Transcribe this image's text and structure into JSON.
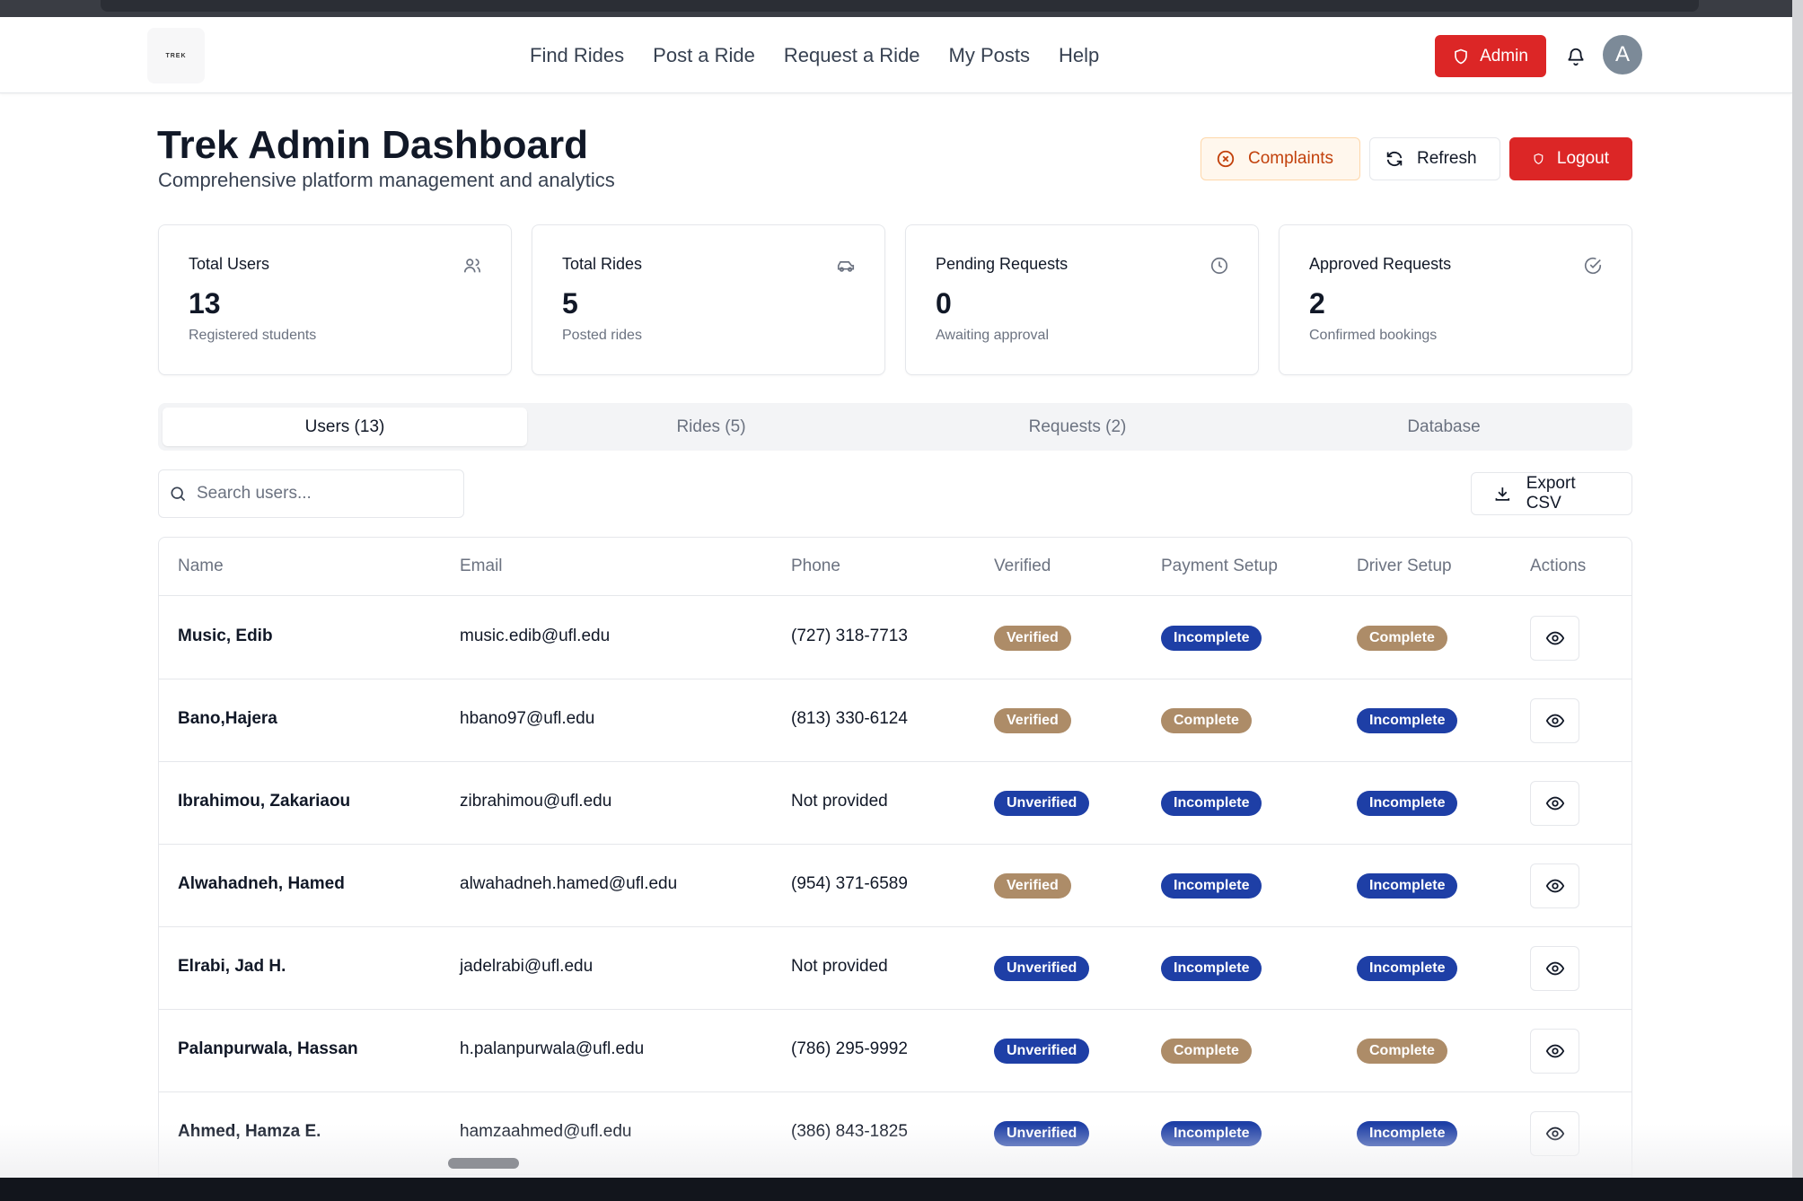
{
  "nav": {
    "logo_text": "TREK",
    "links": [
      "Find Rides",
      "Post a Ride",
      "Request a Ride",
      "My Posts",
      "Help"
    ],
    "admin_label": "Admin",
    "avatar_initial": "A"
  },
  "header": {
    "title": "Trek Admin Dashboard",
    "subtitle": "Comprehensive platform management and analytics",
    "complaints_label": "Complaints",
    "refresh_label": "Refresh",
    "logout_label": "Logout"
  },
  "stats": [
    {
      "title": "Total Users",
      "value": "13",
      "subtitle": "Registered students",
      "icon": "users-icon"
    },
    {
      "title": "Total Rides",
      "value": "5",
      "subtitle": "Posted rides",
      "icon": "car-icon"
    },
    {
      "title": "Pending Requests",
      "value": "0",
      "subtitle": "Awaiting approval",
      "icon": "clock-icon"
    },
    {
      "title": "Approved Requests",
      "value": "2",
      "subtitle": "Confirmed bookings",
      "icon": "check-circle-icon"
    }
  ],
  "tabs": [
    "Users (13)",
    "Rides (5)",
    "Requests (2)",
    "Database"
  ],
  "active_tab": 0,
  "search": {
    "placeholder": "Search users...",
    "value": ""
  },
  "export_label": "Export CSV",
  "table": {
    "headers": [
      "Name",
      "Email",
      "Phone",
      "Verified",
      "Payment Setup",
      "Driver Setup",
      "Actions"
    ],
    "rows": [
      {
        "name": "Music, Edib",
        "email": "music.edib@ufl.edu",
        "phone": "(727) 318-7713",
        "verified": "Verified",
        "payment": "Incomplete",
        "driver": "Complete"
      },
      {
        "name": "Bano,Hajera",
        "email": "hbano97@ufl.edu",
        "phone": "(813) 330-6124",
        "verified": "Verified",
        "payment": "Complete",
        "driver": "Incomplete"
      },
      {
        "name": "Ibrahimou, Zakariaou",
        "email": "zibrahimou@ufl.edu",
        "phone": "Not provided",
        "verified": "Unverified",
        "payment": "Incomplete",
        "driver": "Incomplete"
      },
      {
        "name": "Alwahadneh, Hamed",
        "email": "alwahadneh.hamed@ufl.edu",
        "phone": "(954) 371-6589",
        "verified": "Verified",
        "payment": "Incomplete",
        "driver": "Incomplete"
      },
      {
        "name": "Elrabi, Jad H.",
        "email": "jadelrabi@ufl.edu",
        "phone": "Not provided",
        "verified": "Unverified",
        "payment": "Incomplete",
        "driver": "Incomplete"
      },
      {
        "name": "Palanpurwala, Hassan",
        "email": "h.palanpurwala@ufl.edu",
        "phone": "(786) 295-9992",
        "verified": "Unverified",
        "payment": "Complete",
        "driver": "Complete"
      },
      {
        "name": "Ahmed, Hamza E.",
        "email": "hamzaahmed@ufl.edu",
        "phone": "(386) 843-1825",
        "verified": "Unverified",
        "payment": "Incomplete",
        "driver": "Incomplete"
      }
    ]
  },
  "colors": {
    "danger": "#dc2626",
    "badge_tan": "#ad8c68",
    "badge_blue": "#1e3fa6",
    "complaints_bg": "#fff7ed",
    "complaints_text": "#c2410c"
  }
}
